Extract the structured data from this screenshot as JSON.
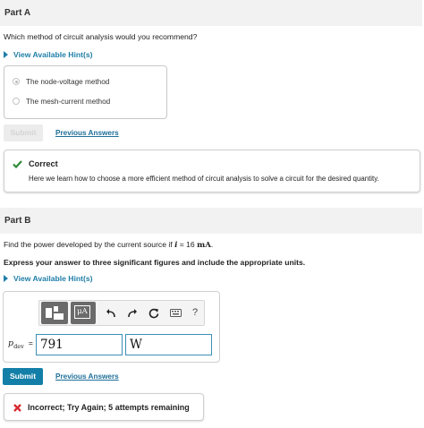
{
  "partA": {
    "header": "Part A",
    "question": "Which method of circuit analysis would you recommend?",
    "hint_label": "View Available Hint(s)",
    "options": [
      {
        "label": "The node-voltage method",
        "selected": true
      },
      {
        "label": "The mesh-current method",
        "selected": false
      }
    ],
    "submit_label": "Submit",
    "prev_answers_label": "Previous Answers",
    "feedback": {
      "status": "Correct",
      "message": "Here we learn how to choose a more efficient method of circuit analysis to solve a circuit for the desired quantity."
    }
  },
  "partB": {
    "header": "Part B",
    "question_prefix": "Find the power developed by the current source if ",
    "question_var": "i",
    "question_eq": " = 16 ",
    "question_unit": "mA",
    "question_suffix": ".",
    "instruction": "Express your answer to three significant figures and include the appropriate units.",
    "hint_label": "View Available Hint(s)",
    "toolbar": {
      "units_label": "μA",
      "help_label": "?"
    },
    "answer": {
      "var_label": "p",
      "var_sub": "dev",
      "eq": "=",
      "value": "791",
      "unit": "W"
    },
    "submit_label": "Submit",
    "prev_answers_label": "Previous Answers",
    "feedback": {
      "status": "Incorrect; Try Again; 5 attempts remaining"
    }
  },
  "colors": {
    "accent": "#137fa8",
    "correct": "#2e8b3a",
    "incorrect": "#d9282f",
    "header_bg": "#f2f2f2"
  }
}
